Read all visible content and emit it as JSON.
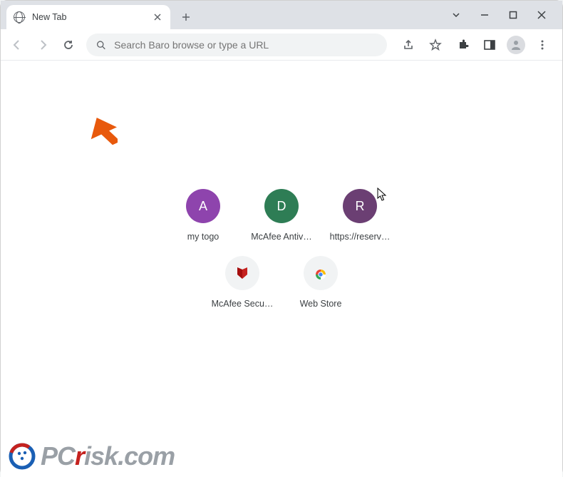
{
  "window": {
    "tab_title": "New Tab"
  },
  "omnibox": {
    "placeholder": "Search Baro browse or type a URL"
  },
  "shortcuts": [
    {
      "label": "my togo",
      "letter": "A",
      "bg": "#8e44ad",
      "icon": "letter"
    },
    {
      "label": "McAfee Antiv…",
      "letter": "D",
      "bg": "#2e7d55",
      "icon": "letter"
    },
    {
      "label": "https://reserv…",
      "letter": "R",
      "bg": "#6b3f73",
      "icon": "letter"
    },
    {
      "label": "McAfee Secu…",
      "letter": "",
      "bg": "#f1f3f4",
      "icon": "mcafee"
    },
    {
      "label": "Web Store",
      "letter": "",
      "bg": "#f1f3f4",
      "icon": "webstore"
    }
  ],
  "watermark": {
    "text_left": "PC",
    "text_mid": "r",
    "text_right": "isk.com"
  },
  "colors": {
    "arrow": "#e8590c"
  }
}
